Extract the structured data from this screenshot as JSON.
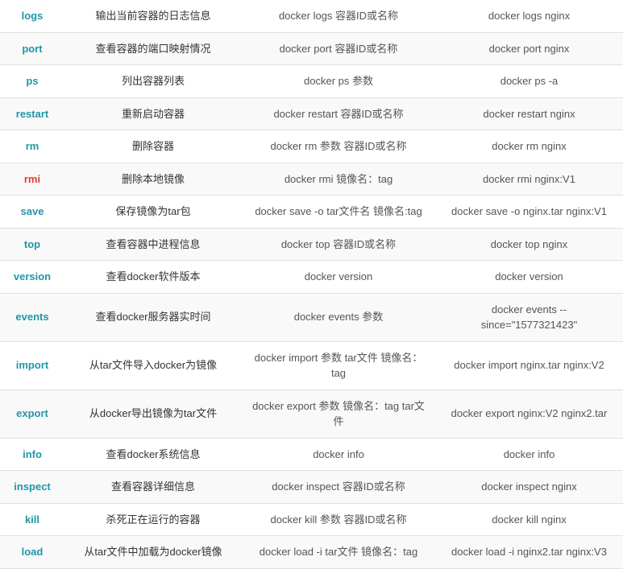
{
  "rows": [
    {
      "cmd": "logs",
      "cmd_color": "normal",
      "desc": "输出当前容器的日志信息",
      "syntax": "docker logs 容器ID或名称",
      "example": "docker logs nginx"
    },
    {
      "cmd": "port",
      "cmd_color": "normal",
      "desc": "查看容器的端口映射情况",
      "syntax": "docker port 容器ID或名称",
      "example": "docker port nginx"
    },
    {
      "cmd": "ps",
      "cmd_color": "normal",
      "desc": "列出容器列表",
      "syntax": "docker ps 参数",
      "example": "docker ps -a"
    },
    {
      "cmd": "restart",
      "cmd_color": "normal",
      "desc": "重新启动容器",
      "syntax": "docker restart 容器ID或名称",
      "example": "docker restart nginx"
    },
    {
      "cmd": "rm",
      "cmd_color": "normal",
      "desc": "删除容器",
      "syntax": "docker rm 参数 容器ID或名称",
      "example": "docker rm nginx"
    },
    {
      "cmd": "rmi",
      "cmd_color": "red",
      "desc": "删除本地镜像",
      "syntax": "docker rmi 镜像名：tag",
      "example": "docker rmi nginx:V1"
    },
    {
      "cmd": "save",
      "cmd_color": "normal",
      "desc": "保存镜像为tar包",
      "syntax": "docker save -o tar文件名 镜像名:tag",
      "example": "docker save -o nginx.tar nginx:V1"
    },
    {
      "cmd": "top",
      "cmd_color": "normal",
      "desc": "查看容器中进程信息",
      "syntax": "docker top 容器ID或名称",
      "example": "docker top nginx"
    },
    {
      "cmd": "version",
      "cmd_color": "normal",
      "desc": "查看docker软件版本",
      "syntax": "docker version",
      "example": "docker version"
    },
    {
      "cmd": "events",
      "cmd_color": "normal",
      "desc": "查看docker服务器实时间",
      "syntax": "docker events 参数",
      "example": "docker events --since=\"1577321423\""
    },
    {
      "cmd": "import",
      "cmd_color": "normal",
      "desc": "从tar文件导入docker为镜像",
      "syntax": "docker import 参数 tar文件 镜像名：tag",
      "example": "docker import nginx.tar nginx:V2"
    },
    {
      "cmd": "export",
      "cmd_color": "normal",
      "desc": "从docker导出镜像为tar文件",
      "syntax": "docker export 参数 镜像名：tag tar文件",
      "example": "docker export nginx:V2 nginx2.tar"
    },
    {
      "cmd": "info",
      "cmd_color": "normal",
      "desc": "查看docker系统信息",
      "syntax": "docker info",
      "example": "docker info"
    },
    {
      "cmd": "inspect",
      "cmd_color": "normal",
      "desc": "查看容器详细信息",
      "syntax": "docker inspect 容器ID或名称",
      "example": "docker inspect nginx"
    },
    {
      "cmd": "kill",
      "cmd_color": "normal",
      "desc": "杀死正在运行的容器",
      "syntax": "docker kill 参数 容器ID或名称",
      "example": "docker kill nginx"
    },
    {
      "cmd": "load",
      "cmd_color": "normal",
      "desc": "从tar文件中加载为docker镜像",
      "syntax": "docker load -i tar文件 镜像名：tag",
      "example": "docker load -i nginx2.tar nginx:V3"
    }
  ]
}
